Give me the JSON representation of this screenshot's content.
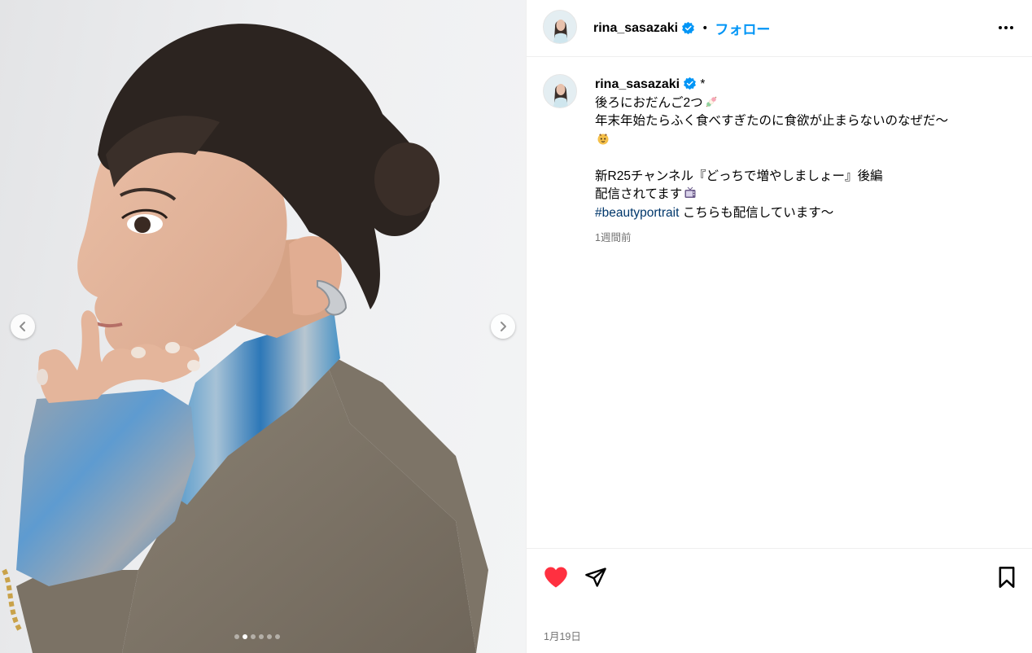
{
  "post": {
    "username": "rina_sasazaki",
    "header_separator": "•",
    "follow_label": "フォロー",
    "caption": {
      "username": "rina_sasazaki",
      "lines": [
        "*",
        "後ろにおだんご2つ",
        "年末年始たらふく食べすぎたのに食欲が止まらないのなぜだ〜",
        "",
        "",
        "新R25チャンネル『どっちで増やしましょー』後編",
        "配信されてます",
        "こちらも配信しています〜"
      ],
      "hashtag": "#beautyportrait"
    },
    "time_ago": "1週間前",
    "date": "1月19日"
  },
  "media": {
    "carousel_total": 6,
    "carousel_active_index": 1
  },
  "icons": {
    "verified": "verified-badge-icon",
    "more": "more-options-icon",
    "like": "heart-icon",
    "share": "paper-plane-icon",
    "save": "bookmark-icon",
    "prev": "chevron-left-icon",
    "next": "chevron-right-icon",
    "emoji_1": "dango-emoji",
    "emoji_2": "face-emoji",
    "emoji_3": "tv-emoji"
  },
  "colors": {
    "link_blue": "#0095f6",
    "hashtag": "#00376b",
    "like_red": "#ff3040",
    "muted_text": "#737373"
  }
}
